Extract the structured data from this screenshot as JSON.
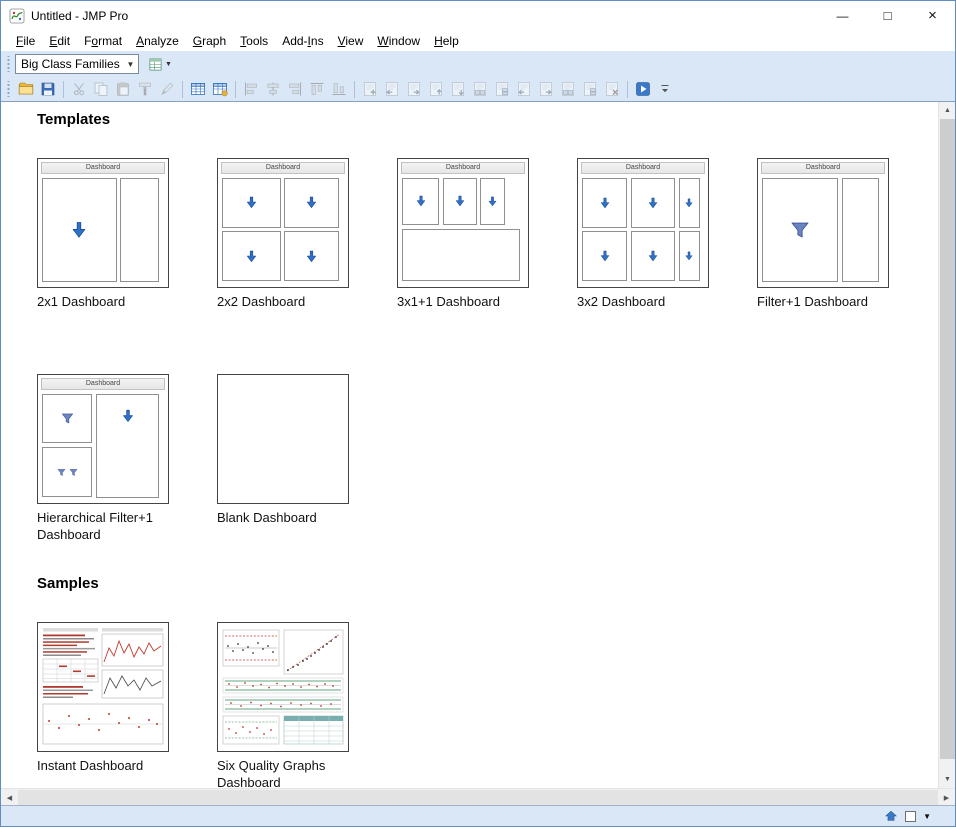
{
  "window": {
    "title": "Untitled - JMP Pro",
    "minimize_glyph": "—",
    "maximize_glyph": "□",
    "close_glyph": "×"
  },
  "menu": {
    "items": [
      {
        "label": "File",
        "accel": 0
      },
      {
        "label": "Edit",
        "accel": 0
      },
      {
        "label": "Format",
        "accel": 1
      },
      {
        "label": "Analyze",
        "accel": 0
      },
      {
        "label": "Graph",
        "accel": 0
      },
      {
        "label": "Tools",
        "accel": 0
      },
      {
        "label": "Add-Ins",
        "accel": 4
      },
      {
        "label": "View",
        "accel": 0
      },
      {
        "label": "Window",
        "accel": 0
      },
      {
        "label": "Help",
        "accel": 0
      }
    ]
  },
  "toolbar": {
    "data_table_combo": {
      "value": "Big Class Families"
    },
    "combo_caret_glyph": "▼",
    "journal_caret_glyph": "▼",
    "icons": [
      {
        "name": "open-icon",
        "kind": "folder",
        "enabled": true
      },
      {
        "name": "save-icon",
        "kind": "disk",
        "enabled": true
      },
      {
        "sep": true
      },
      {
        "name": "cut-icon",
        "kind": "scissors",
        "enabled": false
      },
      {
        "name": "copy-icon",
        "kind": "copy",
        "enabled": false
      },
      {
        "name": "paste-icon",
        "kind": "paste",
        "enabled": false
      },
      {
        "name": "format-painter-icon",
        "kind": "brush",
        "enabled": false
      },
      {
        "name": "annotate-icon",
        "kind": "pen",
        "enabled": false
      },
      {
        "sep": true
      },
      {
        "name": "data-table-icon",
        "kind": "table",
        "enabled": true
      },
      {
        "name": "data-table-window-icon",
        "kind": "table2",
        "enabled": true
      },
      {
        "sep": true
      },
      {
        "name": "align-left-icon",
        "kind": "alignl",
        "enabled": false
      },
      {
        "name": "align-center-icon",
        "kind": "alignc",
        "enabled": false
      },
      {
        "name": "align-right-icon",
        "kind": "alignr",
        "enabled": false
      },
      {
        "name": "align-top-icon",
        "kind": "alignt",
        "enabled": false
      },
      {
        "name": "align-bottom-icon",
        "kind": "alignb",
        "enabled": false
      },
      {
        "sep": true
      },
      {
        "name": "new-report-icon",
        "kind": "page",
        "dir": "plus",
        "enabled": false
      },
      {
        "name": "add-report-left-icon",
        "kind": "page",
        "dir": "left",
        "enabled": false
      },
      {
        "name": "add-report-right-icon",
        "kind": "page",
        "dir": "right",
        "enabled": false
      },
      {
        "name": "add-report-above-icon",
        "kind": "page",
        "dir": "up",
        "enabled": false
      },
      {
        "name": "add-report-below-icon",
        "kind": "page",
        "dir": "down",
        "enabled": false
      },
      {
        "name": "insert-column-icon",
        "kind": "page",
        "dir": "h",
        "enabled": false
      },
      {
        "name": "insert-row-icon",
        "kind": "page",
        "dir": "v",
        "enabled": false
      },
      {
        "name": "move-report-left-icon",
        "kind": "page",
        "dir": "left",
        "enabled": false
      },
      {
        "name": "move-report-right-icon",
        "kind": "page",
        "dir": "right",
        "enabled": false
      },
      {
        "name": "merge-reports-icon",
        "kind": "page",
        "dir": "h",
        "enabled": false
      },
      {
        "name": "split-report-icon",
        "kind": "page",
        "dir": "v",
        "enabled": false
      },
      {
        "name": "remove-report-icon",
        "kind": "page",
        "dir": "x",
        "enabled": false
      },
      {
        "sep": true
      },
      {
        "name": "run-dashboard-icon",
        "kind": "launch",
        "enabled": true
      },
      {
        "name": "toolbar-overflow-icon",
        "kind": "chevron",
        "enabled": true
      }
    ]
  },
  "content": {
    "thumb_titlebar": "Dashboard",
    "sections": [
      {
        "title": "Templates",
        "items": [
          {
            "label": "2x1 Dashboard",
            "type": "t2x1"
          },
          {
            "label": "2x2 Dashboard",
            "type": "t2x2"
          },
          {
            "label": "3x1+1 Dashboard",
            "type": "t3x1p1"
          },
          {
            "label": "3x2 Dashboard",
            "type": "t3x2"
          },
          {
            "label": "Filter+1 Dashboard",
            "type": "tfilter1"
          },
          {
            "label": "Hierarchical Filter+1 Dashboard",
            "type": "thier"
          },
          {
            "label": "Blank Dashboard",
            "type": "tblank"
          }
        ]
      },
      {
        "title": "Samples",
        "items": [
          {
            "label": "Instant Dashboard",
            "type": "tinstant"
          },
          {
            "label": "Six Quality Graphs Dashboard",
            "type": "tsix"
          }
        ]
      }
    ]
  },
  "scrollbar": {
    "up_glyph": "▲",
    "down_glyph": "▼",
    "left_glyph": "◀",
    "right_glyph": "▶"
  },
  "statusbar": {
    "caret_glyph": "▼"
  },
  "colors": {
    "toolbar_bg": "#d9e7f7",
    "arrow_blue": "#2f70c8",
    "funnel_blue": "#6b84c4",
    "window_border": "#5f8fc0"
  }
}
